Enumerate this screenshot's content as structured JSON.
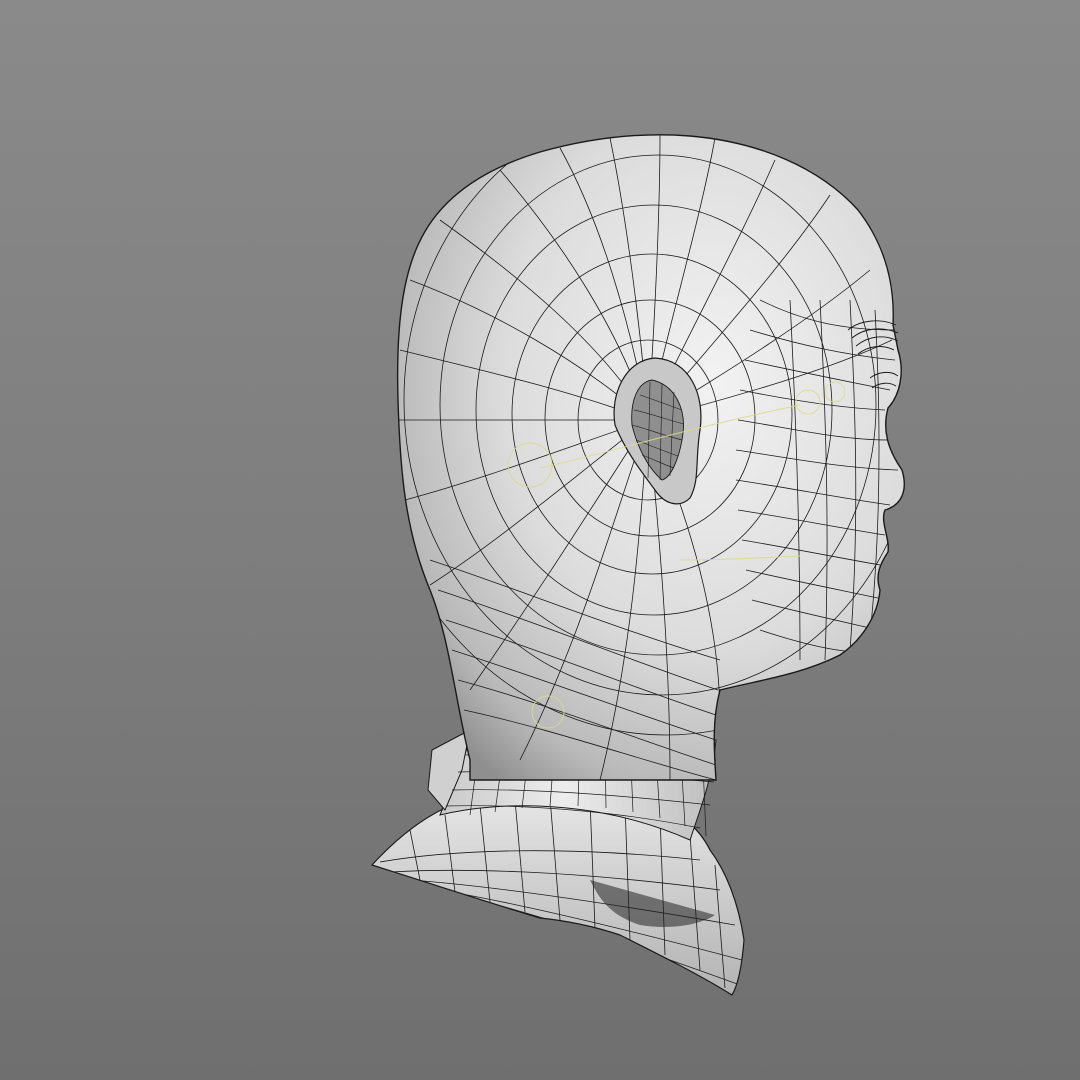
{
  "scene": {
    "subject": "head-wireframe-model",
    "background_color_top": "#8a8a8a",
    "background_color_bottom": "#6f6f6f",
    "mesh_fill_color": "#e6e6e6",
    "mesh_line_color": "#1a1a1a",
    "helper_curve_color": "#d8dc8a"
  }
}
